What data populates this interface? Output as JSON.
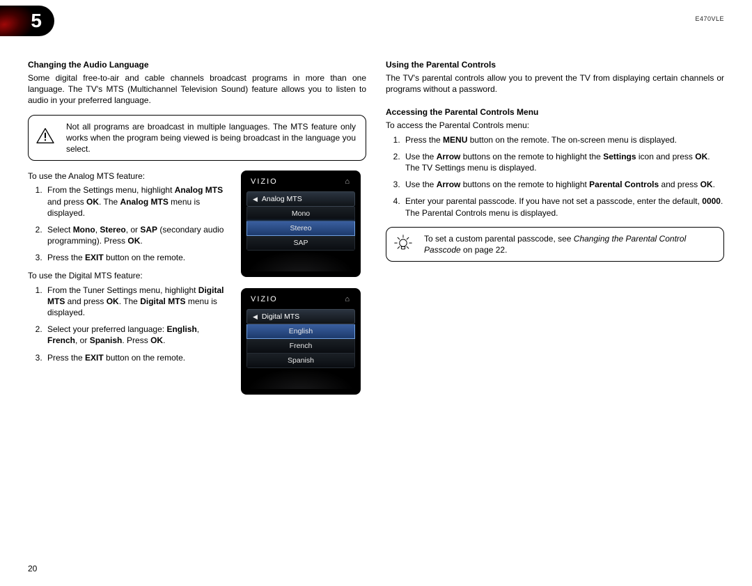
{
  "header": {
    "chapter": "5",
    "model": "E470VLE"
  },
  "page_number": "20",
  "left": {
    "h1": "Changing the Audio Language",
    "intro": "Some digital free-to-air and cable channels broadcast programs in more than one language. The TV's MTS (Multichannel Television Sound) feature allows you to listen to audio in your preferred language.",
    "warn": "Not all programs are broadcast in multiple languages. The MTS feature only works when the program being viewed is being broadcast in the language you select.",
    "analog_intro": "To use the Analog MTS feature:",
    "analog_steps": {
      "s1a": "From the Settings menu, highlight ",
      "s1b": "Analog MTS",
      "s1c": " and press ",
      "s1d": "OK",
      "s1e": ". The ",
      "s1f": "Analog MTS",
      "s1g": " menu is displayed.",
      "s2a": "Select ",
      "s2b": "Mono",
      "s2c": ", ",
      "s2d": "Stereo",
      "s2e": ", or ",
      "s2f": "SAP",
      "s2g": " (secondary audio programming). Press ",
      "s2h": "OK",
      "s2i": ".",
      "s3a": "Press the ",
      "s3b": "EXIT",
      "s3c": " button on the remote."
    },
    "digital_intro": "To use the Digital MTS feature:",
    "digital_steps": {
      "s1a": "From the Tuner Settings menu, highlight ",
      "s1b": "Digital MTS",
      "s1c": " and press ",
      "s1d": "OK",
      "s1e": ". The ",
      "s1f": "Digital MTS",
      "s1g": " menu is displayed.",
      "s2a": "Select your preferred language: ",
      "s2b": "English",
      "s2c": ", ",
      "s2d": "French",
      "s2e": ", or ",
      "s2f": "Spanish",
      "s2g": ". Press ",
      "s2h": "OK",
      "s2i": ".",
      "s3a": "Press the ",
      "s3b": "EXIT",
      "s3c": " button on the remote."
    },
    "menu1": {
      "brand": "VIZIO",
      "title": "Analog MTS",
      "items": [
        "Mono",
        "Stereo",
        "SAP"
      ],
      "selected": 1
    },
    "menu2": {
      "brand": "VIZIO",
      "title": "Digital MTS",
      "items": [
        "English",
        "French",
        "Spanish"
      ],
      "selected": 0
    }
  },
  "right": {
    "h1": "Using the Parental Controls",
    "intro": "The TV's parental controls allow you to prevent the TV from displaying certain channels or programs without a password.",
    "h2": "Accessing the Parental Controls Menu",
    "intro2": "To access the Parental Controls menu:",
    "steps": {
      "s1a": "Press the ",
      "s1b": "MENU",
      "s1c": " button on the remote. The on-screen menu is displayed.",
      "s2a": "Use the ",
      "s2b": "Arrow",
      "s2c": " buttons on the remote to highlight the ",
      "s2d": "Settings",
      "s2e": " icon and press ",
      "s2f": "OK",
      "s2g": ". The TV Settings menu is displayed.",
      "s3a": "Use the ",
      "s3b": "Arrow",
      "s3c": " buttons on the remote to highlight ",
      "s3d": "Parental Controls",
      "s3e": " and press ",
      "s3f": "OK",
      "s3g": ".",
      "s4a": "Enter your parental passcode. If you have not set a passcode, enter the default, ",
      "s4b": "0000",
      "s4c": ". The Parental Controls menu is displayed."
    },
    "tip": {
      "a": "To set a custom parental passcode, see ",
      "b": "Changing the Parental Control Passcode",
      "c": " on page 22."
    }
  }
}
